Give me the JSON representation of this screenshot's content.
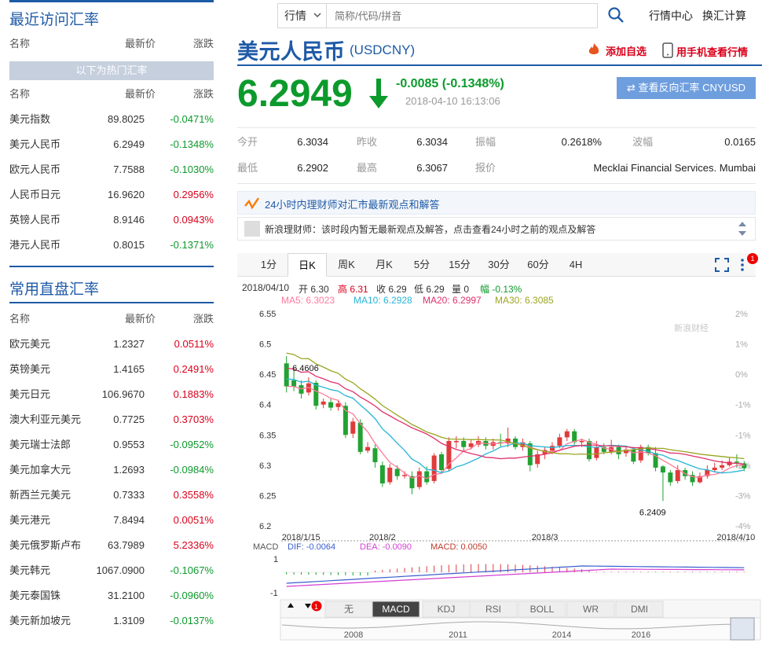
{
  "left": {
    "recent": {
      "title": "最近访问汇率",
      "header": {
        "name": "名称",
        "price": "最新价",
        "change": "涨跌"
      },
      "hot_bar": "以下为热门汇率",
      "header2": {
        "name": "名称",
        "price": "最新价",
        "change": "涨跌"
      },
      "rows": [
        {
          "name": "美元指数",
          "price": "89.8025",
          "change": "-0.0471%",
          "dir": "down"
        },
        {
          "name": "美元人民币",
          "price": "6.2949",
          "change": "-0.1348%",
          "dir": "down"
        },
        {
          "name": "欧元人民币",
          "price": "7.7588",
          "change": "-0.1030%",
          "dir": "down"
        },
        {
          "name": "人民币日元",
          "price": "16.9620",
          "change": "0.2956%",
          "dir": "up"
        },
        {
          "name": "英镑人民币",
          "price": "8.9146",
          "change": "0.0943%",
          "dir": "up"
        },
        {
          "name": "港元人民币",
          "price": "0.8015",
          "change": "-0.1371%",
          "dir": "down"
        }
      ]
    },
    "direct": {
      "title": "常用直盘汇率",
      "header": {
        "name": "名称",
        "price": "最新价",
        "change": "涨跌"
      },
      "rows": [
        {
          "name": "欧元美元",
          "price": "1.2327",
          "change": "0.0511%",
          "dir": "up"
        },
        {
          "name": "英镑美元",
          "price": "1.4165",
          "change": "0.2491%",
          "dir": "up"
        },
        {
          "name": "美元日元",
          "price": "106.9670",
          "change": "0.1883%",
          "dir": "up"
        },
        {
          "name": "澳大利亚元美元",
          "price": "0.7725",
          "change": "0.3703%",
          "dir": "up"
        },
        {
          "name": "美元瑞士法郎",
          "price": "0.9553",
          "change": "-0.0952%",
          "dir": "down"
        },
        {
          "name": "美元加拿大元",
          "price": "1.2693",
          "change": "-0.0984%",
          "dir": "down"
        },
        {
          "name": "新西兰元美元",
          "price": "0.7333",
          "change": "0.3558%",
          "dir": "up"
        },
        {
          "name": "美元港元",
          "price": "7.8494",
          "change": "0.0051%",
          "dir": "up"
        },
        {
          "name": "美元俄罗斯卢布",
          "price": "63.7989",
          "change": "5.2336%",
          "dir": "up"
        },
        {
          "name": "美元韩元",
          "price": "1067.0900",
          "change": "-0.1067%",
          "dir": "down"
        },
        {
          "name": "美元泰国铢",
          "price": "31.2100",
          "change": "-0.0960%",
          "dir": "down"
        },
        {
          "name": "美元新加坡元",
          "price": "1.3109",
          "change": "-0.0137%",
          "dir": "down"
        }
      ]
    }
  },
  "nav": {
    "select": "行情",
    "search_placeholder": "简称/代码/拼音",
    "links": [
      "行情中心",
      "换汇计算"
    ]
  },
  "quote": {
    "title": "美元人民币",
    "code": "(USDCNY)",
    "add_fav": "添加自选",
    "mobile": "用手机查看行情",
    "price": "6.2949",
    "change": "-0.0085 (-0.1348%)",
    "time": "2018-04-10 16:13:06",
    "reverse_btn": "⇄ 查看反向汇率 CNYUSD"
  },
  "stats": [
    {
      "label": "今开",
      "value": "6.3034"
    },
    {
      "label": "昨收",
      "value": "6.3034"
    },
    {
      "label": "振幅",
      "value": "0.2618%"
    },
    {
      "label": "波幅",
      "value": "0.0165"
    },
    {
      "label": "最低",
      "value": "6.2902"
    },
    {
      "label": "最高",
      "value": "6.3067"
    },
    {
      "label": "报价",
      "value": "Mecklai Financial Services. Mumbai"
    }
  ],
  "advisor": {
    "title": "24小时内理财师对汇市最新观点和解答",
    "row": "新浪理财师：该时段内暂无最新观点及解答，点击查看24小时之前的观点及解答"
  },
  "chart_tabs": [
    "1分",
    "日K",
    "周K",
    "月K",
    "5分",
    "15分",
    "30分",
    "60分",
    "4H"
  ],
  "chart_badge": "1",
  "legend": {
    "ohlc": [
      {
        "text": "2018/04/10",
        "color": "#333333"
      },
      {
        "text": "开 6.30",
        "color": "#333333"
      },
      {
        "text": "高 6.31",
        "color": "#d9001b"
      },
      {
        "text": "收 6.29",
        "color": "#333333"
      },
      {
        "text": "低 6.29",
        "color": "#333333"
      },
      {
        "text": "量 0",
        "color": "#333333"
      },
      {
        "text": "幅 -0.13%",
        "color": "#0c9a2c"
      }
    ],
    "ma": [
      {
        "text": "MA5: 6.3023",
        "color": "#ff7a9a"
      },
      {
        "text": "MA10: 6.2928",
        "color": "#27b6d6"
      },
      {
        "text": "MA20: 6.2997",
        "color": "#e0306c"
      },
      {
        "text": "MA30: 6.3085",
        "color": "#9aa520"
      }
    ],
    "macd": [
      {
        "text": "MACD",
        "color": "#555555"
      },
      {
        "text": "DIF: -0.0064",
        "color": "#3a5fcd"
      },
      {
        "text": "DEA: -0.0090",
        "color": "#d23fd2"
      },
      {
        "text": "MACD: 0.0050",
        "color": "#c0392b"
      }
    ]
  },
  "watermark": "新浪财经",
  "indicator_tabs": [
    "无",
    "MACD",
    "KDJ",
    "RSI",
    "BOLL",
    "WR",
    "DMI"
  ],
  "indicator_badge": "1",
  "overview_years": [
    "2008",
    "2011",
    "2014",
    "2016"
  ],
  "chart_data": {
    "type": "candlestick",
    "ylim": [
      6.2,
      6.55
    ],
    "yticks": [
      "6.55",
      "6.5",
      "6.45",
      "6.4",
      "6.35",
      "6.3",
      "6.25",
      "6.2"
    ],
    "yticks_right": [
      "2%",
      "1%",
      "0%",
      "-1%",
      "-1%",
      "-2%",
      "-3%",
      "-4%"
    ],
    "xticks": [
      {
        "label": "2018/1/15",
        "index": 0
      },
      {
        "label": "2018/2",
        "index": 13
      },
      {
        "label": "2018/3",
        "index": 35
      },
      {
        "label": "2018/4/10",
        "index": 62
      }
    ],
    "annotations": [
      {
        "text": "6.4606",
        "index": 1,
        "value": 6.4606
      },
      {
        "text": "6.2409",
        "index": 51,
        "value": 6.2409
      }
    ],
    "candles": [
      [
        6.468,
        6.43,
        6.48,
        6.42
      ],
      [
        6.44,
        6.43,
        6.461,
        6.422
      ],
      [
        6.432,
        6.418,
        6.44,
        6.41
      ],
      [
        6.42,
        6.435,
        6.445,
        6.415
      ],
      [
        6.436,
        6.398,
        6.44,
        6.392
      ],
      [
        6.4,
        6.405,
        6.41,
        6.394
      ],
      [
        6.404,
        6.395,
        6.41,
        6.39
      ],
      [
        6.396,
        6.402,
        6.408,
        6.39
      ],
      [
        6.398,
        6.35,
        6.404,
        6.345
      ],
      [
        6.352,
        6.372,
        6.378,
        6.345
      ],
      [
        6.37,
        6.322,
        6.376,
        6.318
      ],
      [
        6.324,
        6.33,
        6.338,
        6.32
      ],
      [
        6.328,
        6.305,
        6.334,
        6.296
      ],
      [
        6.3,
        6.27,
        6.306,
        6.264
      ],
      [
        6.272,
        6.296,
        6.302,
        6.268
      ],
      [
        6.294,
        6.282,
        6.3,
        6.276
      ],
      [
        6.284,
        6.284,
        6.29,
        6.278
      ],
      [
        6.282,
        6.262,
        6.29,
        6.252
      ],
      [
        6.264,
        6.29,
        6.296,
        6.26
      ],
      [
        6.29,
        6.272,
        6.298,
        6.268
      ],
      [
        6.274,
        6.316,
        6.32,
        6.27
      ],
      [
        6.318,
        6.292,
        6.322,
        6.288
      ],
      [
        6.294,
        6.34,
        6.346,
        6.29
      ],
      [
        6.338,
        6.34,
        6.348,
        6.328
      ],
      [
        6.34,
        6.33,
        6.346,
        6.324
      ],
      [
        6.33,
        6.336,
        6.342,
        6.326
      ],
      [
        6.334,
        6.34,
        6.348,
        6.33
      ],
      [
        6.34,
        6.332,
        6.346,
        6.326
      ],
      [
        6.332,
        6.338,
        6.344,
        6.326
      ],
      [
        6.338,
        6.336,
        6.352,
        6.33
      ],
      [
        6.336,
        6.344,
        6.362,
        6.33
      ],
      [
        6.344,
        6.33,
        6.348,
        6.326
      ],
      [
        6.33,
        6.338,
        6.344,
        6.324
      ],
      [
        6.336,
        6.3,
        6.34,
        6.29
      ],
      [
        6.302,
        6.318,
        6.324,
        6.296
      ],
      [
        6.318,
        6.325,
        6.33,
        6.31
      ],
      [
        6.324,
        6.332,
        6.338,
        6.318
      ],
      [
        6.332,
        6.346,
        6.352,
        6.328
      ],
      [
        6.346,
        6.356,
        6.36,
        6.34
      ],
      [
        6.356,
        6.338,
        6.36,
        6.334
      ],
      [
        6.338,
        6.34,
        6.344,
        6.33
      ],
      [
        6.34,
        6.31,
        6.344,
        6.306
      ],
      [
        6.312,
        6.33,
        6.34,
        6.308
      ],
      [
        6.33,
        6.322,
        6.336,
        6.318
      ],
      [
        6.322,
        6.33,
        6.342,
        6.318
      ],
      [
        6.33,
        6.318,
        6.334,
        6.31
      ],
      [
        6.32,
        6.326,
        6.332,
        6.314
      ],
      [
        6.326,
        6.306,
        6.33,
        6.302
      ],
      [
        6.308,
        6.33,
        6.334,
        6.304
      ],
      [
        6.33,
        6.32,
        6.334,
        6.316
      ],
      [
        6.32,
        6.296,
        6.33,
        6.29
      ],
      [
        6.298,
        6.288,
        6.3,
        6.241
      ],
      [
        6.288,
        6.272,
        6.292,
        6.266
      ],
      [
        6.274,
        6.292,
        6.3,
        6.27
      ],
      [
        6.292,
        6.282,
        6.296,
        6.276
      ],
      [
        6.284,
        6.272,
        6.29,
        6.266
      ],
      [
        6.272,
        6.282,
        6.288,
        6.27
      ],
      [
        6.282,
        6.292,
        6.3,
        6.278
      ],
      [
        6.292,
        6.296,
        6.304,
        6.288
      ],
      [
        6.296,
        6.3,
        6.308,
        6.292
      ],
      [
        6.3,
        6.306,
        6.312,
        6.298
      ],
      [
        6.306,
        6.304,
        6.318,
        6.296
      ],
      [
        6.303,
        6.295,
        6.307,
        6.29
      ]
    ]
  }
}
